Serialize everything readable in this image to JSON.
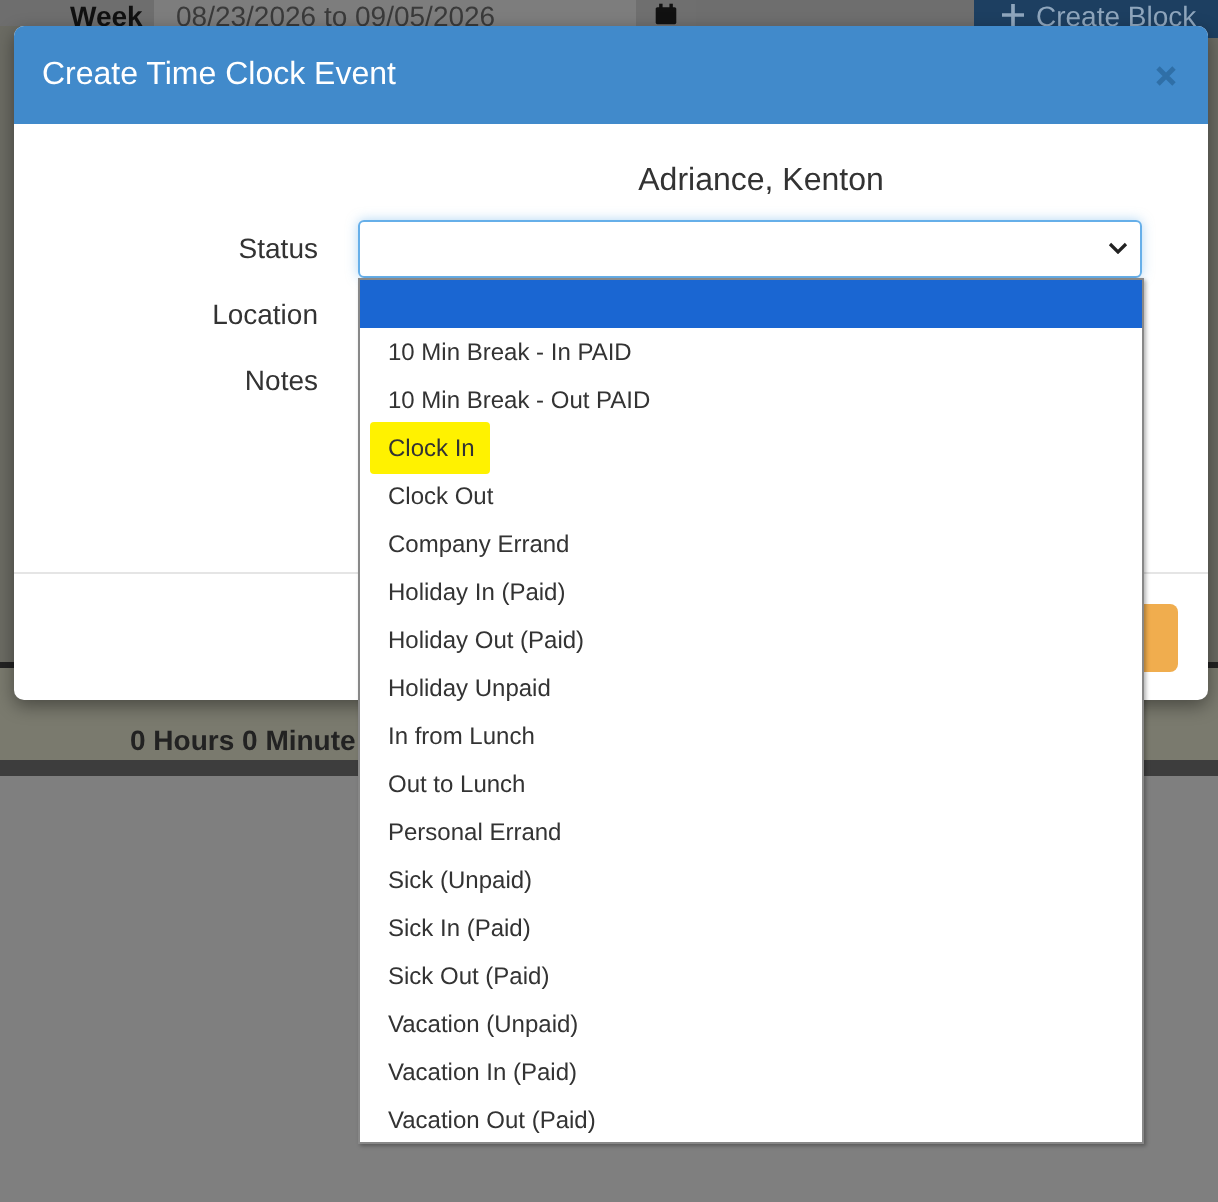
{
  "page_header": {
    "week_label": "Week",
    "week_range": "08/23/2026 to 09/05/2026",
    "create_button": "Create Block"
  },
  "background_row": {
    "total": "0 Hours 0 Minute"
  },
  "dialog": {
    "title": "Create Time Clock Event",
    "employee": "Adriance, Kenton",
    "fields": [
      {
        "label": "Status",
        "kind": "select"
      },
      {
        "label": "Location",
        "kind": "text"
      },
      {
        "label": "Notes",
        "kind": "text"
      }
    ],
    "status_options": [
      {
        "selected": true,
        "marked": false
      },
      {
        "label": "10 Min Break - In PAID",
        "selected": false,
        "marked": false
      },
      {
        "label": "10 Min Break - Out PAID",
        "selected": false,
        "marked": false
      },
      {
        "label": "Clock In",
        "selected": false,
        "marked": true
      },
      {
        "label": "Clock Out",
        "selected": false,
        "marked": false
      },
      {
        "label": "Company Errand",
        "selected": false,
        "marked": false
      },
      {
        "label": "Holiday In (Paid)",
        "selected": false,
        "marked": false
      },
      {
        "label": "Holiday Out (Paid)",
        "selected": false,
        "marked": false
      },
      {
        "label": "Holiday Unpaid",
        "selected": false,
        "marked": false
      },
      {
        "label": "In from Lunch",
        "selected": false,
        "marked": false
      },
      {
        "label": "Out to Lunch",
        "selected": false,
        "marked": false
      },
      {
        "label": "Personal Errand",
        "selected": false,
        "marked": false
      },
      {
        "label": "Sick (Unpaid)",
        "selected": false,
        "marked": false
      },
      {
        "label": "Sick In (Paid)",
        "selected": false,
        "marked": false
      },
      {
        "label": "Sick Out (Paid)",
        "selected": false,
        "marked": false
      },
      {
        "label": "Vacation (Unpaid)",
        "selected": false,
        "marked": false
      },
      {
        "label": "Vacation In (Paid)",
        "selected": false,
        "marked": false
      },
      {
        "label": "Vacation Out (Paid)",
        "selected": false,
        "marked": false
      }
    ]
  }
}
